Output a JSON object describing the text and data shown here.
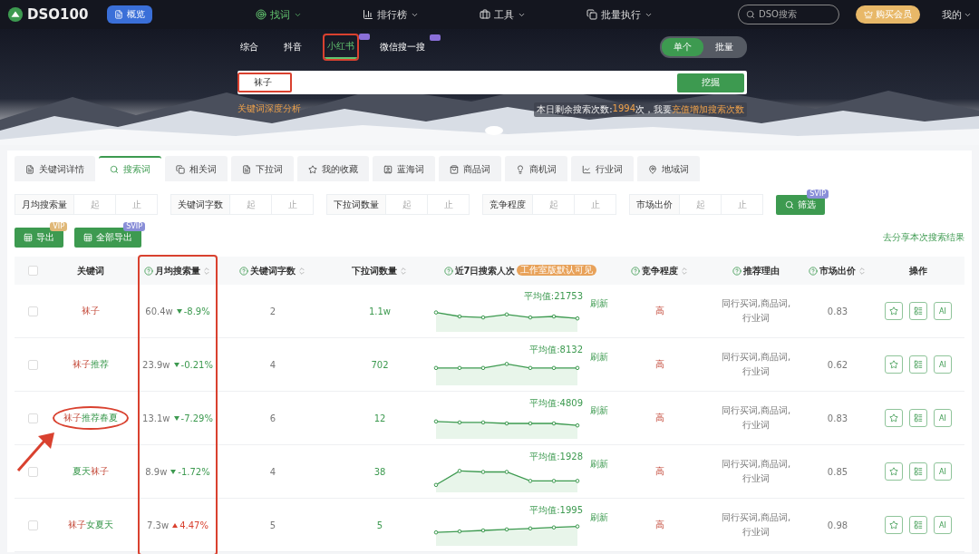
{
  "header": {
    "logo": "DSO100",
    "overview": "概览",
    "nav": [
      {
        "label": "找词",
        "selected": true
      },
      {
        "label": "排行榜",
        "selected": false
      },
      {
        "label": "工具",
        "selected": false
      },
      {
        "label": "批量执行",
        "selected": false
      }
    ],
    "search": {
      "placeholder": "DSO搜索"
    },
    "vip": "购买会员",
    "account": "我的"
  },
  "banner": {
    "platforms": [
      {
        "label": "综合",
        "selected": false,
        "badge": false,
        "highlighted": false
      },
      {
        "label": "抖音",
        "selected": false,
        "badge": false,
        "highlighted": false
      },
      {
        "label": "小红书",
        "selected": true,
        "badge": true,
        "highlighted": true
      },
      {
        "label": "微信搜一搜",
        "selected": false,
        "badge": true,
        "highlighted": false
      }
    ],
    "modes": [
      {
        "label": "单个",
        "selected": true
      },
      {
        "label": "批量",
        "selected": false
      }
    ],
    "input": {
      "value": "袜子",
      "highlighted": true
    },
    "dig": "挖掘",
    "analysis_link": "关键词深度分析",
    "quota_prefix": "本日剩余搜索次数:",
    "quota_count": "1994",
    "quota_mid": "次，我要",
    "quota_link": "充值增加搜索次数"
  },
  "tabs": [
    {
      "label": "关键词详情",
      "selected": false
    },
    {
      "label": "搜索词",
      "selected": true
    },
    {
      "label": "相关词",
      "selected": false
    },
    {
      "label": "下拉词",
      "selected": false
    },
    {
      "label": "我的收藏",
      "selected": false
    },
    {
      "label": "蓝海词",
      "selected": false
    },
    {
      "label": "商品词",
      "selected": false
    },
    {
      "label": "商机词",
      "selected": false
    },
    {
      "label": "行业词",
      "selected": false
    },
    {
      "label": "地域词",
      "selected": false
    }
  ],
  "filters": [
    {
      "label": "月均搜索量",
      "from": {
        "placeholder": "起"
      },
      "to": {
        "placeholder": "止"
      }
    },
    {
      "label": "关键词字数",
      "from": {
        "placeholder": "起"
      },
      "to": {
        "placeholder": "止"
      }
    },
    {
      "label": "下拉词数量",
      "from": {
        "placeholder": "起"
      },
      "to": {
        "placeholder": "止"
      }
    },
    {
      "label": "竞争程度",
      "from": {
        "placeholder": "起"
      },
      "to": {
        "placeholder": "止"
      }
    },
    {
      "label": "市场出价",
      "from": {
        "placeholder": "起"
      },
      "to": {
        "placeholder": "止"
      }
    }
  ],
  "filter_button": {
    "label": "筛选",
    "badge": "SVIP"
  },
  "export_buttons": [
    {
      "label": "导出",
      "badge": "VIP"
    },
    {
      "label": "全部导出",
      "badge": "SVIP"
    }
  ],
  "share_link": "去分享本次搜索结果",
  "table": {
    "all_checked": false,
    "columns": [
      {
        "label": "关键词",
        "help": false,
        "sortable": false,
        "highlighted": false
      },
      {
        "label": "月均搜索量",
        "help": true,
        "sortable": true,
        "highlighted": true
      },
      {
        "label": "关键词字数",
        "help": true,
        "sortable": true,
        "highlighted": false
      },
      {
        "label": "下拉词数量",
        "help": false,
        "sortable": true,
        "highlighted": false
      },
      {
        "label": "近7日搜索人次",
        "help": true,
        "sortable": false,
        "highlighted": false,
        "badge": "工作室版默认可见"
      },
      {
        "label": "竞争程度",
        "help": true,
        "sortable": true,
        "highlighted": false
      },
      {
        "label": "推荐理由",
        "help": true,
        "sortable": false,
        "highlighted": false
      },
      {
        "label": "市场出价",
        "help": true,
        "sortable": true,
        "highlighted": false
      },
      {
        "label": "操作",
        "help": false,
        "sortable": false,
        "highlighted": false
      }
    ],
    "rows": [
      {
        "checked": false,
        "keyword": [
          {
            "text": "袜子",
            "match": true
          }
        ],
        "circled": false,
        "volume": "60.4w",
        "rising": false,
        "change": "-8.9%",
        "chars": "2",
        "dropdown": "1.1w",
        "average": "平均值:21753",
        "refresh": "刷新",
        "competition": "高",
        "reason": "同行买词,商品词,行业词",
        "price": "0.83",
        "ai": "AI"
      },
      {
        "checked": false,
        "keyword": [
          {
            "text": "袜子",
            "match": true
          },
          {
            "text": "推荐",
            "match": false
          }
        ],
        "circled": false,
        "volume": "23.9w",
        "rising": false,
        "change": "-0.21%",
        "chars": "4",
        "dropdown": "702",
        "average": "平均值:8132",
        "refresh": "刷新",
        "competition": "高",
        "reason": "同行买词,商品词,行业词",
        "price": "0.62",
        "ai": "AI"
      },
      {
        "checked": false,
        "keyword": [
          {
            "text": "袜子",
            "match": true
          },
          {
            "text": "推荐春夏",
            "match": false
          }
        ],
        "circled": true,
        "volume": "13.1w",
        "rising": false,
        "change": "-7.29%",
        "chars": "6",
        "dropdown": "12",
        "average": "平均值:4809",
        "refresh": "刷新",
        "competition": "高",
        "reason": "同行买词,商品词,行业词",
        "price": "0.83",
        "ai": "AI"
      },
      {
        "checked": false,
        "keyword": [
          {
            "text": "夏天",
            "match": false
          },
          {
            "text": "袜子",
            "match": true
          }
        ],
        "circled": false,
        "volume": "8.9w",
        "rising": false,
        "change": "-1.72%",
        "chars": "4",
        "dropdown": "38",
        "average": "平均值:1928",
        "refresh": "刷新",
        "competition": "高",
        "reason": "同行买词,商品词,行业词",
        "price": "0.85",
        "ai": "AI"
      },
      {
        "checked": false,
        "keyword": [
          {
            "text": "袜子",
            "match": true
          },
          {
            "text": "女夏天",
            "match": false
          }
        ],
        "circled": false,
        "volume": "7.3w",
        "rising": true,
        "change": "4.47%",
        "chars": "5",
        "dropdown": "5",
        "average": "平均值:1995",
        "refresh": "刷新",
        "competition": "高",
        "reason": "同行买词,商品词,行业词",
        "price": "0.98",
        "ai": "AI"
      }
    ]
  }
}
